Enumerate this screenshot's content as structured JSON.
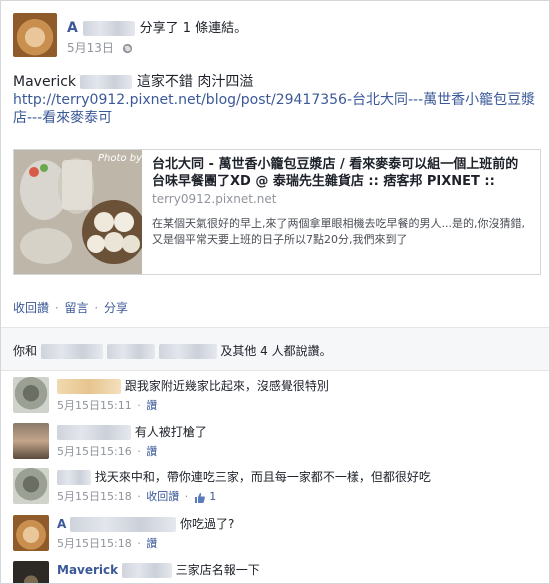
{
  "post": {
    "author_visible": "A",
    "action_text": "分享了 1 條連結。",
    "timestamp": "5月13日",
    "message_name": "Maverick",
    "message_text": "這家不錯 肉汁四溢",
    "url_text": "http://terry0912.pixnet.net/blog/post/29417356-台北大同---萬世香小籠包豆漿店---看來麥泰可"
  },
  "preview": {
    "title": "台北大同 - 萬世香小籠包豆漿店 / 看來麥泰可以組一個上班前的台味早餐團了XD @ 泰瑞先生雜貨店 :: 痞客邦 PIXNET ::",
    "domain": "terry0912.pixnet.net",
    "description": "在某個天氣很好的早上,來了两個拿單眼相機去吃早餐的男人...是的,你沒猜錯,又是個平常天要上班的日子所以7點20分,我們來到了",
    "watermark": "Photo by"
  },
  "actions": {
    "unlike": "收回讚",
    "comment": "留言",
    "share": "分享",
    "separator": "·"
  },
  "likes": {
    "prefix": "你和",
    "suffix": "及其他 4 人都說讚。"
  },
  "comments": [
    {
      "name_visible": "",
      "text": "跟我家附近幾家比起來，沒感覺很特別",
      "time": "5月15日15:11",
      "like": "讚"
    },
    {
      "name_visible": "",
      "text": "有人被打槍了",
      "time": "5月15日15:16",
      "like": "讚"
    },
    {
      "name_visible": "",
      "text": "找天來中和，帶你連吃三家，而且每一家都不一樣，但都很好吃",
      "time": "5月15日15:18",
      "like": "收回讚",
      "like_count": "1"
    },
    {
      "name_visible": "A",
      "text": "你吃過了?",
      "time": "5月15日15:18",
      "like": "讚"
    },
    {
      "name_visible": "Maverick",
      "text": "三家店名報一下",
      "time": "",
      "like": ""
    }
  ],
  "icons": {
    "globe": "globe-icon",
    "thumb": "thumbs-up-icon"
  },
  "colors": {
    "link": "#3b5998",
    "meta": "#90949c",
    "text": "#1d2129"
  }
}
